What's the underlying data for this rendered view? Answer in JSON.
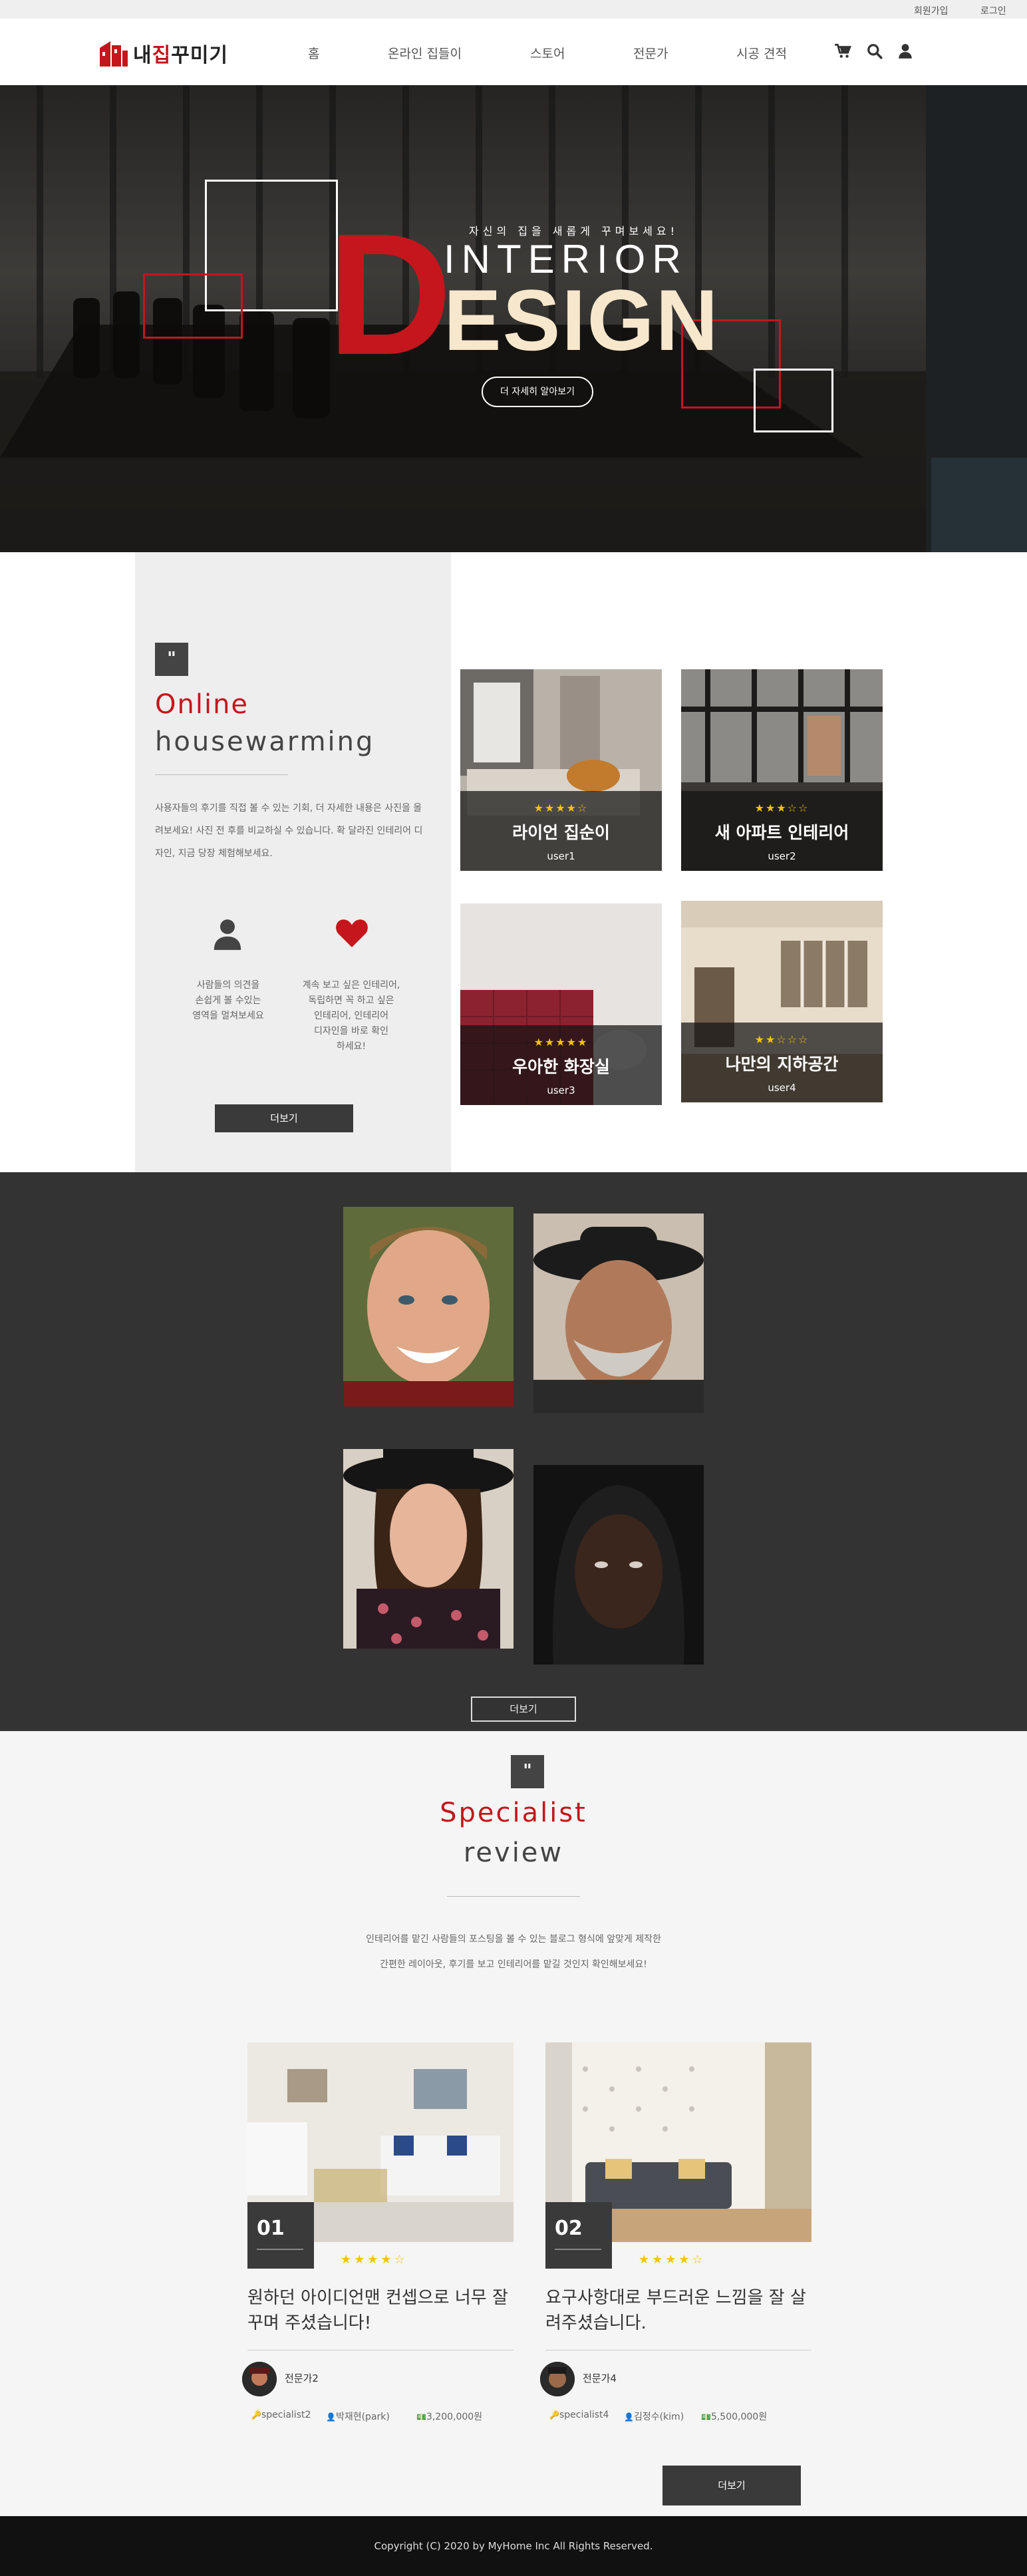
{
  "topbar": {
    "signup": "회원가입",
    "login": "로그인"
  },
  "header": {
    "logo_pre": "내",
    "logo_mid": "집",
    "logo_post": "꾸미기",
    "nav": [
      "홈",
      "온라인 집들이",
      "스토어",
      "전문가",
      "시공 견적"
    ]
  },
  "hero": {
    "tagline": "자신의 집을 새롭게 꾸며보세요!",
    "word1": "INTERIOR",
    "word2_first": "D",
    "word2_rest": "ESIGN",
    "button": "더 자세히 알아보기"
  },
  "online": {
    "quote": "\"",
    "title_accent": "Online",
    "title_main": "housewarming",
    "description": "사용자들의 후기를 직접 볼 수 있는 기회, 더 자세한 내용은 사진을 올려보세요! 사진 전 후를 비교하실 수 있습니다. 확 달라진 인테리어 디자인, 지금 당장 체험해보세요.",
    "feature1": "사람들의 의견을\n손쉽게 볼 수있는\n영역을 멀쳐보세요",
    "feature2": "계속 보고 싶은 인테리어,\n독립하면 꼭 하고 싶은\n인테리어, 인테리어\n디자인을 바로 확인\n하세요!",
    "more": "더보기",
    "cards": [
      {
        "title": "라이언 집순이",
        "user": "user1",
        "stars": "★★★★☆",
        "rating": 4
      },
      {
        "title": "새 아파트 인테리어",
        "user": "user2",
        "stars": "★★★☆☆",
        "rating": 3
      },
      {
        "title": "우아한 화장실",
        "user": "user3",
        "stars": "★★★★★",
        "rating": 5
      },
      {
        "title": "나만의 지하공간",
        "user": "user4",
        "stars": "★★☆☆☆",
        "rating": 2
      }
    ]
  },
  "people": {
    "more": "더보기"
  },
  "specialist": {
    "quote": "\"",
    "title_accent": "Specialist",
    "title_main": "review",
    "description1": "인테리어를 맡긴 사람들의 포스팅을 볼 수 있는 블로그 형식에 앞맞게 제작한",
    "description2": "간편한 레이아웃, 후기를 보고 인테리어를 맡길 것인지 확인해보세요!",
    "reviews": [
      {
        "num": "01",
        "stars": "★★★★☆",
        "rating": 4,
        "title": "원하던 아이디언맨 컨셉으로 너무 잘 꾸며 주셨습니다!",
        "name": "전문가2",
        "id": "specialist2",
        "client": "박재현(park)",
        "price": "3,200,000원"
      },
      {
        "num": "02",
        "stars": "★★★★☆",
        "rating": 4,
        "title": "요구사항대로 부드러운 느낌을 잘 살려주셨습니다.",
        "name": "전문가4",
        "id": "specialist4",
        "client": "김정수(kim)",
        "price": "5,500,000원"
      }
    ],
    "more": "더보기"
  },
  "footer": {
    "copyright": "Copyright (C) 2020 by MyHome Inc All Rights Reserved."
  },
  "colors": {
    "accent": "#c4161c",
    "dark_bg": "#333333",
    "star": "#f4c400"
  }
}
